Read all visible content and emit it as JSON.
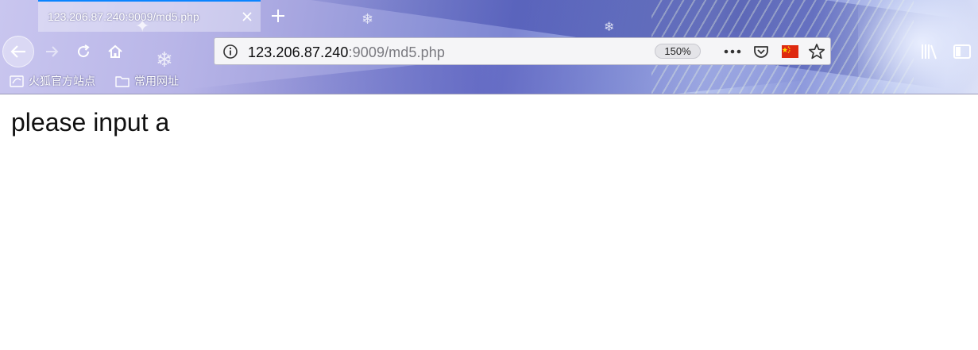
{
  "tab": {
    "title": "123.206.87.240:9009/md5.php"
  },
  "urlbar": {
    "host": "123.206.87.240",
    "rest": ":9009/md5.php",
    "zoom": "150%"
  },
  "bookmarks": [
    {
      "label": "火狐官方站点",
      "icon": "firefox-icon"
    },
    {
      "label": "常用网址",
      "icon": "folder-icon"
    }
  ],
  "page": {
    "message": "please input a"
  },
  "colors": {
    "tab_accent": "#0a84ff",
    "page_bg": "#ffffff",
    "text": "#111111",
    "flag_red": "#de2910",
    "flag_star": "#ffde00"
  }
}
